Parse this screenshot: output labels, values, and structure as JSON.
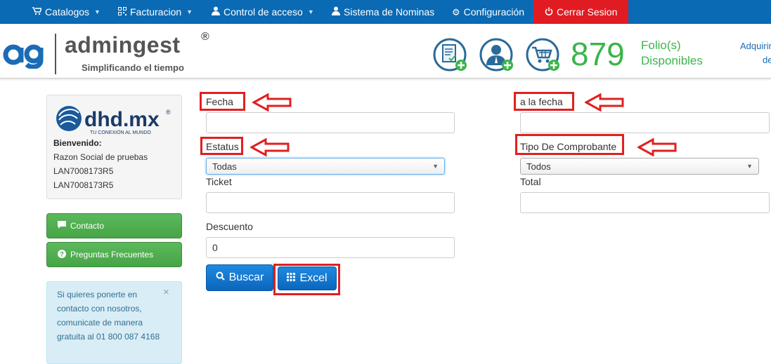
{
  "nav": {
    "catalogos": "Catalogos",
    "facturacion": "Facturacion",
    "control": "Control de acceso",
    "nominas": "Sistema de Nominas",
    "config": "Configuración",
    "logout": "Cerrar Sesion"
  },
  "header": {
    "brand_name": "admingest",
    "brand_reg": "®",
    "brand_tag": "Simplificando el tiempo",
    "folio_count": "879",
    "folio_label_1": "Folio(s)",
    "folio_label_2": "Disponibles",
    "acquire_1": "Adquirir",
    "acquire_2": "de"
  },
  "sidebar": {
    "company_logo_text": "dhd.mx",
    "company_logo_reg": "®",
    "company_tagline": "TU CONEXIÓN AL MUNDO",
    "welcome": "Bienvenido:",
    "razon_social": "Razon Social de pruebas",
    "rfc_1": "LAN7008173R5",
    "rfc_2": "LAN7008173R5",
    "contacto": "Contacto",
    "faq": "Preguntas Frecuentes",
    "info": "Si quieres ponerte en contacto con nosotros, comunicate de manera gratuita al 01 800 087 4168",
    "info_close": "×"
  },
  "form": {
    "fecha_label": "Fecha",
    "fecha_value": "",
    "a_la_fecha_label": "a la fecha",
    "a_la_fecha_value": "",
    "estatus_label": "Estatus",
    "estatus_value": "Todas",
    "tipo_label": "Tipo De Comprobante",
    "tipo_value": "Todos",
    "ticket_label": "Ticket",
    "ticket_value": "",
    "total_label": "Total",
    "total_value": "",
    "descuento_label": "Descuento",
    "descuento_value": "0",
    "buscar": "Buscar",
    "excel": "Excel"
  },
  "colors": {
    "nav_bg": "#0a6ab4",
    "logout_bg": "#e11b22",
    "accent_green": "#3bb54a",
    "button_blue": "#1474cc",
    "annotation_red": "#e02020"
  },
  "icons": [
    "cart-icon",
    "qr-icon",
    "user-icon",
    "gear-icon",
    "power-icon",
    "comment-icon",
    "question-icon",
    "search-icon",
    "grid-icon"
  ]
}
